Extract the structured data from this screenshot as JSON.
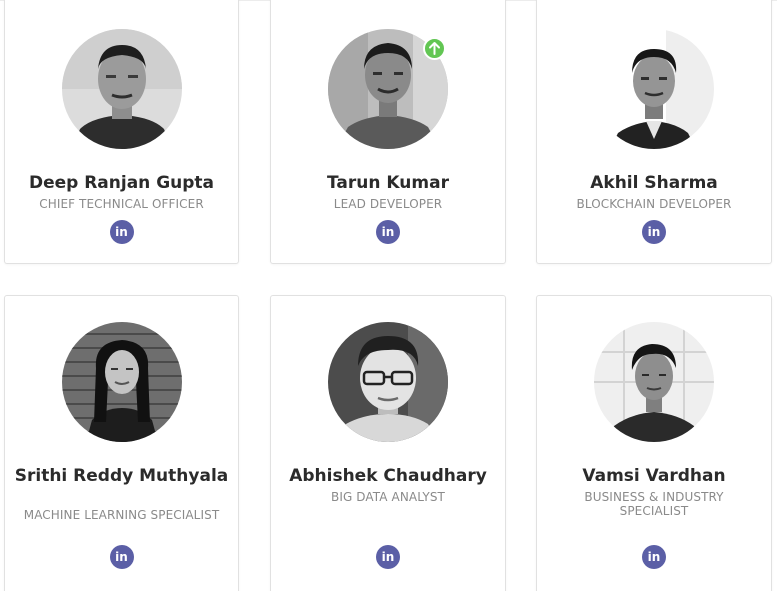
{
  "team": [
    {
      "name": "Deep Ranjan Gupta",
      "role": "CHIEF TECHNICAL OFFICER",
      "social": "in",
      "avatar_icon": "portrait-icon"
    },
    {
      "name": "Tarun Kumar",
      "role": "LEAD DEVELOPER",
      "social": "in",
      "avatar_icon": "portrait-icon",
      "badge_icon": "arrow-up-icon",
      "badge_color": "#62c653"
    },
    {
      "name": "Akhil Sharma",
      "role": "BLOCKCHAIN DEVELOPER",
      "social": "in",
      "avatar_icon": "portrait-icon"
    },
    {
      "name": "Srithi Reddy Muthyala",
      "role": "MACHINE LEARNING SPECIALIST",
      "social": "in",
      "avatar_icon": "portrait-icon"
    },
    {
      "name": "Abhishek Chaudhary",
      "role": "BIG DATA ANALYST",
      "social": "in",
      "avatar_icon": "portrait-icon"
    },
    {
      "name": "Vamsi Vardhan",
      "role": "BUSINESS & INDUSTRY SPECIALIST",
      "social": "in",
      "avatar_icon": "portrait-icon"
    }
  ],
  "colors": {
    "linkedin": "#5b5fa6",
    "name_text": "#2b2b2b",
    "role_text": "#8a8a8a",
    "card_border": "#e1e1e1"
  }
}
